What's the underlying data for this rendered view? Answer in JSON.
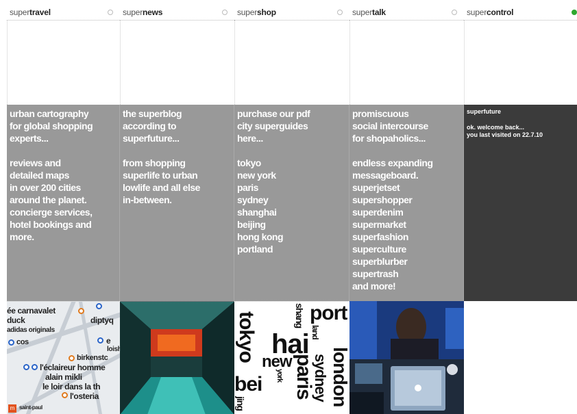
{
  "tabs": [
    {
      "prefix": "super",
      "name": "travel",
      "active": false
    },
    {
      "prefix": "super",
      "name": "news",
      "active": false
    },
    {
      "prefix": "super",
      "name": "shop",
      "active": false
    },
    {
      "prefix": "super",
      "name": "talk",
      "active": false
    },
    {
      "prefix": "super",
      "name": "control",
      "active": true
    }
  ],
  "panels": {
    "travel": {
      "intro": [
        "urban cartography",
        "for global shopping",
        "experts..."
      ],
      "body": [
        "reviews and",
        "detailed maps",
        "in over 200 cities",
        "around the planet.",
        "concierge services,",
        "hotel bookings and",
        "more."
      ]
    },
    "news": {
      "intro": [
        "the superblog",
        "according to",
        "superfuture..."
      ],
      "body": [
        "from shopping",
        "superlife to urban",
        "lowlife and all else",
        "in-between."
      ]
    },
    "shop": {
      "intro": [
        "purchase our pdf",
        "city superguides",
        "here..."
      ],
      "body": [
        "tokyo",
        "new york",
        "paris",
        "sydney",
        "shanghai",
        "beijing",
        "hong kong",
        "portland"
      ]
    },
    "talk": {
      "intro": [
        "promiscuous",
        "social intercourse",
        "for shopaholics..."
      ],
      "body": [
        "endless expanding",
        "messageboard.",
        "superjetset",
        "supershopper",
        "superdenim",
        "supermarket",
        "superfashion",
        "superculture",
        "superblurber",
        "supertrash",
        "and more!"
      ]
    },
    "control": {
      "title": "superfuture",
      "lines": [
        "ok. welcome back...",
        "you last visited on 22.7.10"
      ]
    }
  },
  "map_labels": [
    "ée carnavalet",
    "duck",
    "diptyq",
    "adidas originals",
    "cos",
    "e",
    "loish",
    "birkenstc",
    "l'éclaireur homme",
    "alain mikli",
    "le loir dans la th",
    "l'osteria",
    "saint-paul"
  ],
  "city_words": [
    "tokyo",
    "shang",
    "hai",
    "port",
    "land",
    "new",
    "york",
    "paris",
    "sydney",
    "london",
    "bei",
    "jing"
  ],
  "colors": {
    "panel": "#999999",
    "control_panel": "#3b3b3b",
    "active_dot": "#2fa82f"
  }
}
